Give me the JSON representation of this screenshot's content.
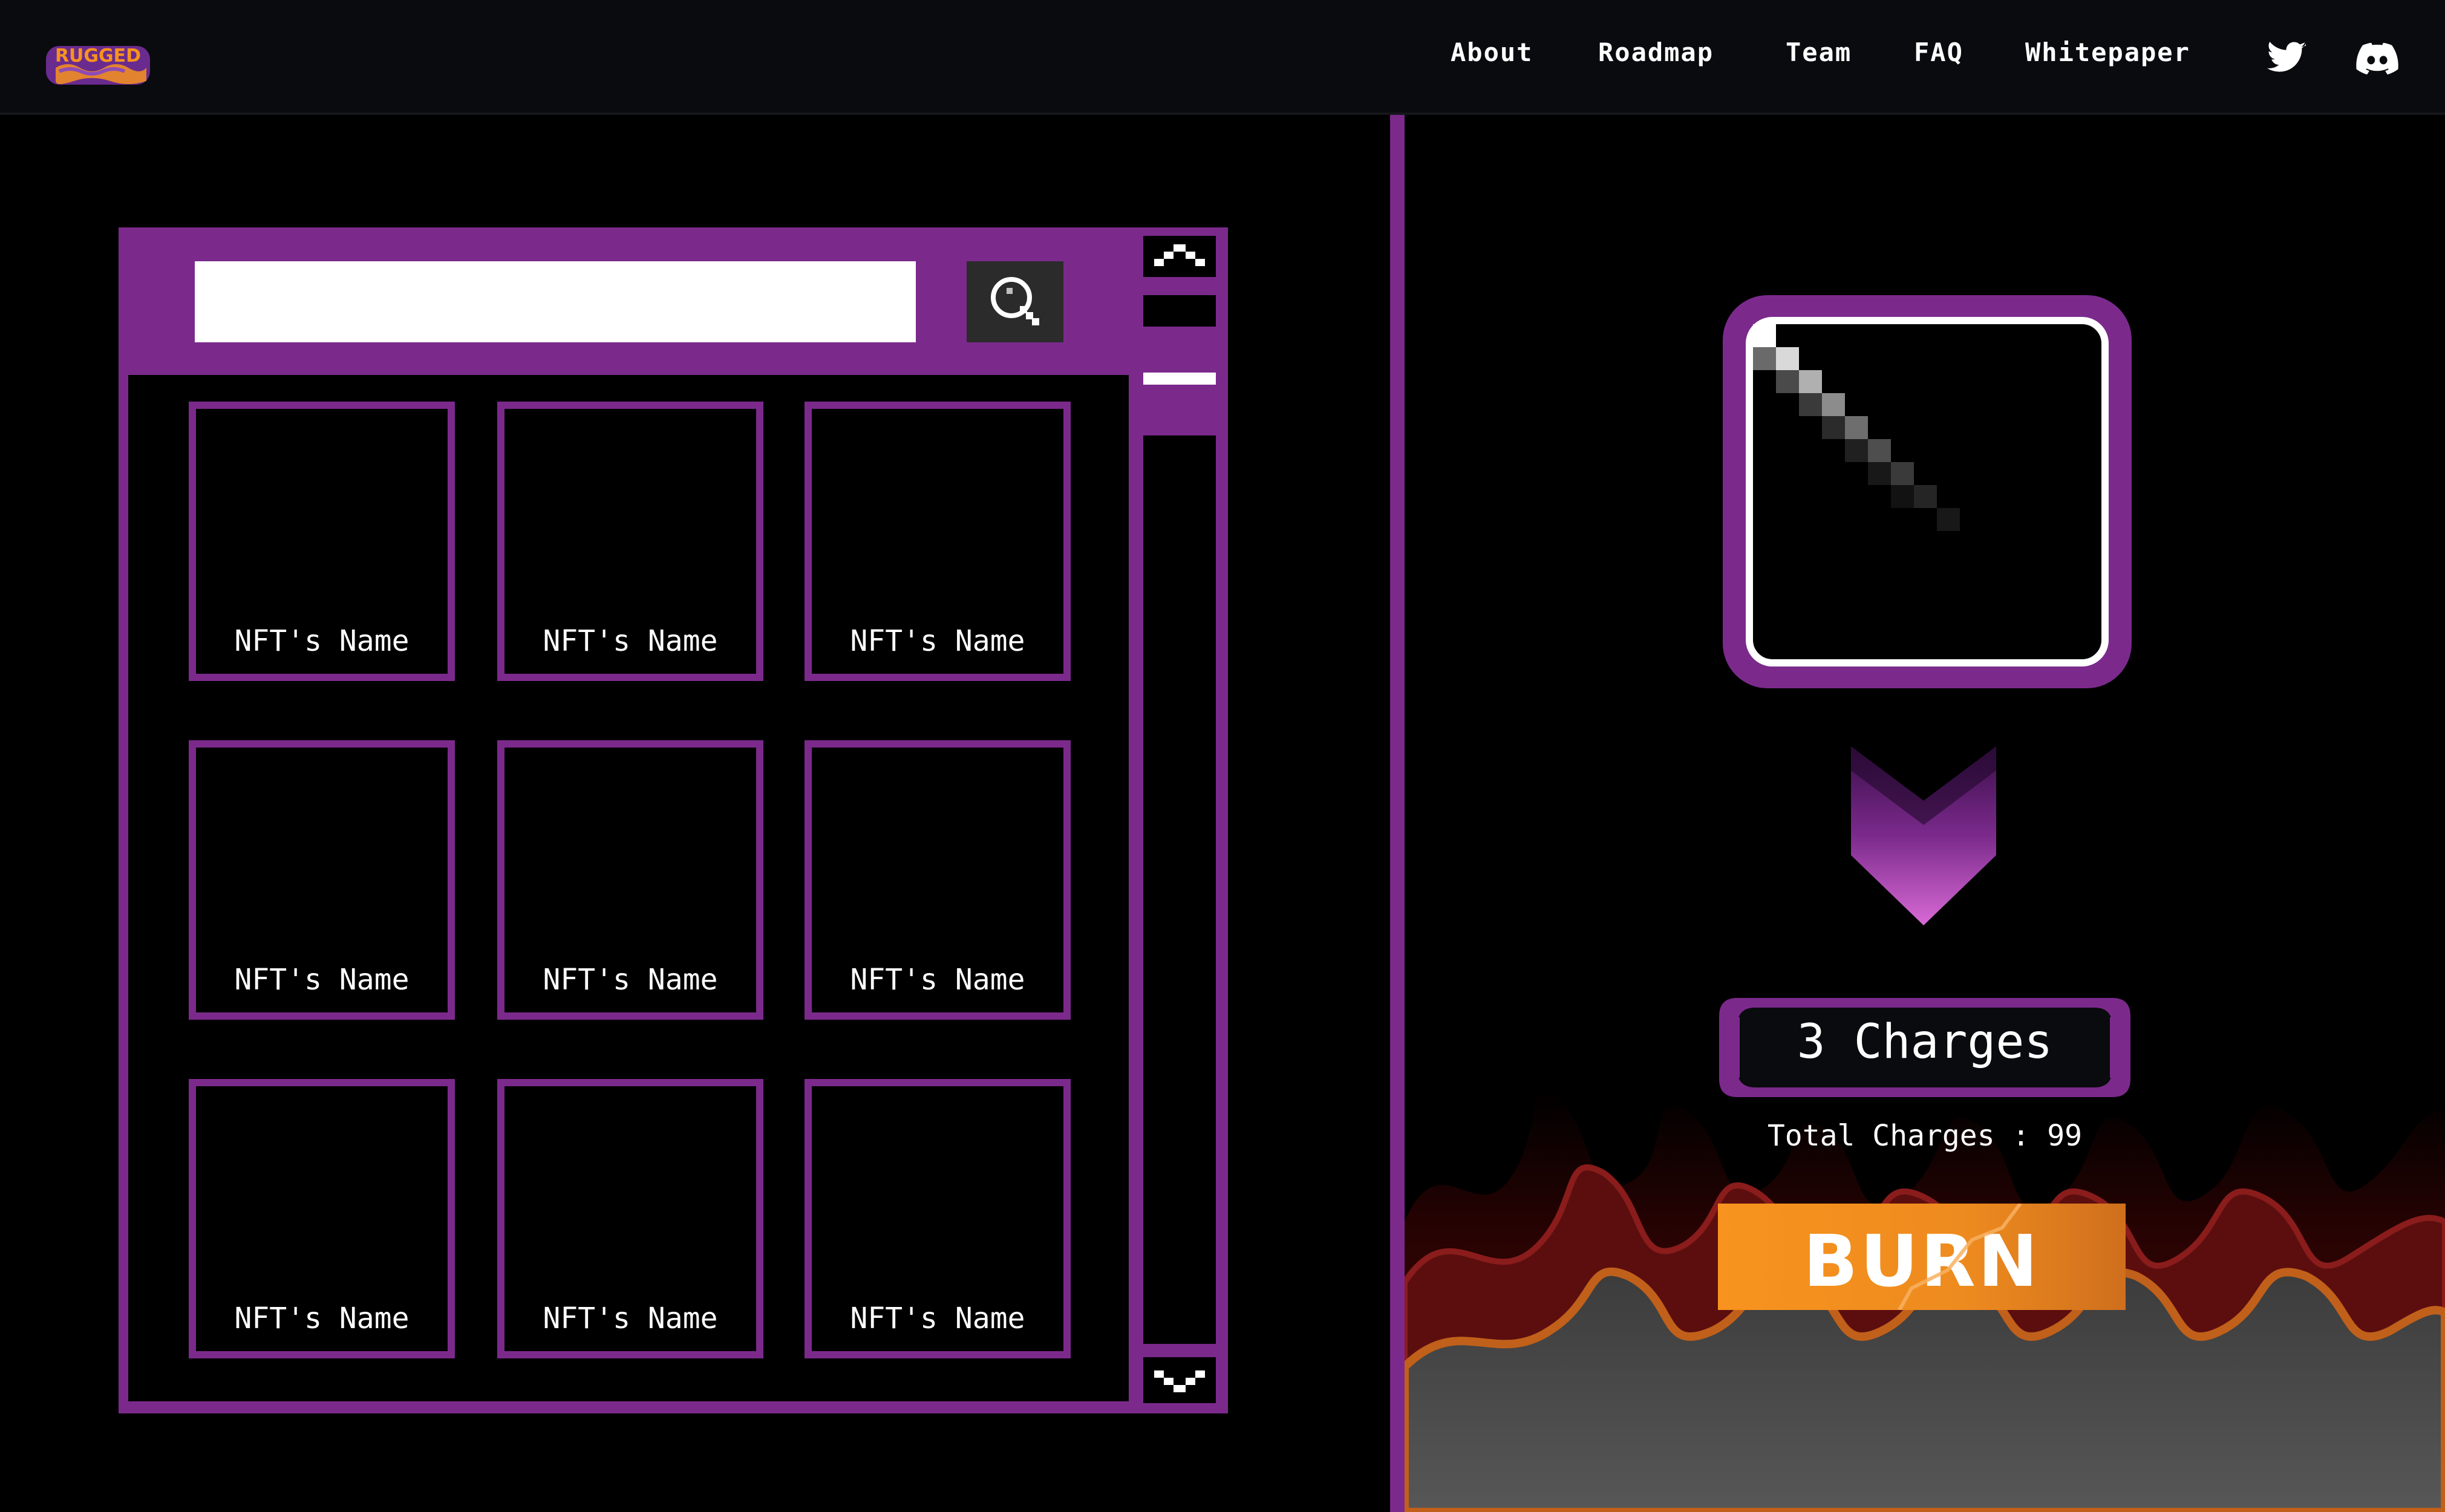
{
  "header": {
    "logo_text": "RUGGED",
    "nav": [
      "About",
      "Roadmap",
      "Team",
      "FAQ",
      "Whitepaper"
    ],
    "social_icons": [
      "twitter-icon",
      "discord-icon"
    ]
  },
  "search": {
    "placeholder": "",
    "value": "",
    "button_icon": "search-icon"
  },
  "nft_grid": {
    "items": [
      {
        "name": "NFT's Name"
      },
      {
        "name": "NFT's Name"
      },
      {
        "name": "NFT's Name"
      },
      {
        "name": "NFT's Name"
      },
      {
        "name": "NFT's Name"
      },
      {
        "name": "NFT's Name"
      },
      {
        "name": "NFT's Name"
      },
      {
        "name": "NFT's Name"
      },
      {
        "name": "NFT's Name"
      }
    ]
  },
  "burn_panel": {
    "charges_label": "3 Charges",
    "total_charges_label": "Total Charges : 99",
    "burn_label": "BURN"
  },
  "colors": {
    "accent_purple": "#7b2a8c",
    "burn_orange": "#f7931e",
    "header_bg": "#0a0b0e"
  }
}
